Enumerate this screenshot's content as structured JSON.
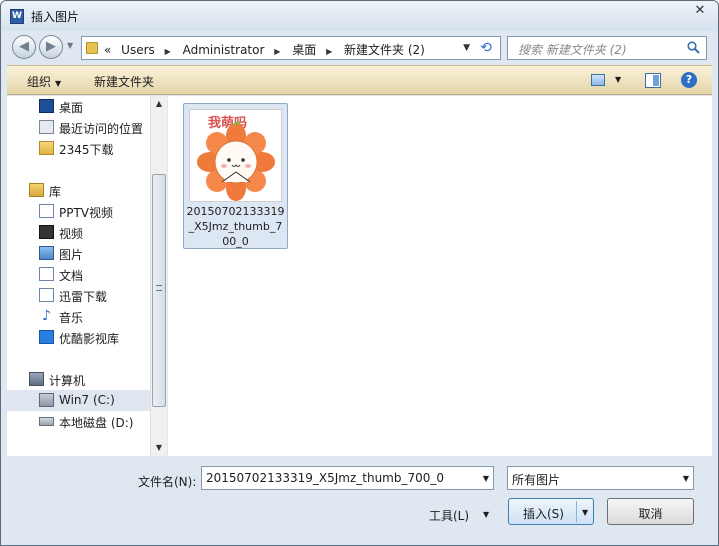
{
  "window": {
    "title": "插入图片",
    "close": "✕"
  },
  "address": {
    "crumb_prefix": "«",
    "crumbs": [
      "Users",
      "Administrator",
      "桌面",
      "新建文件夹 (2)"
    ],
    "search_placeholder": "搜索 新建文件夹 (2)"
  },
  "toolbar": {
    "organize": "组织",
    "new_folder": "新建文件夹",
    "help": "?"
  },
  "nav": {
    "items": [
      {
        "label": "桌面",
        "icon": "desktop-icon"
      },
      {
        "label": "最近访问的位置",
        "icon": "recent-places-icon"
      },
      {
        "label": "2345下载",
        "icon": "folder-icon"
      },
      {
        "label": "库",
        "icon": "library-icon"
      },
      {
        "label": "PPTV视频",
        "icon": "document-folder-icon"
      },
      {
        "label": "视频",
        "icon": "video-icon"
      },
      {
        "label": "图片",
        "icon": "pictures-icon"
      },
      {
        "label": "文档",
        "icon": "documents-icon"
      },
      {
        "label": "迅雷下载",
        "icon": "download-folder-icon"
      },
      {
        "label": "音乐",
        "icon": "music-icon"
      },
      {
        "label": "优酷影视库",
        "icon": "youku-icon"
      },
      {
        "label": "计算机",
        "icon": "computer-icon"
      },
      {
        "label": "Win7 (C:)",
        "icon": "drive-c-icon"
      },
      {
        "label": "本地磁盘 (D:)",
        "icon": "drive-d-icon"
      }
    ],
    "selected_index": 12
  },
  "files": [
    {
      "name": "20150702133319_X5Jmz_thumb_700_0",
      "thumb_caption": "我萌吗"
    }
  ],
  "bottom": {
    "filename_label": "文件名(N):",
    "filename_value": "20150702133319_X5Jmz_thumb_700_0",
    "type_value": "所有图片",
    "tools_label": "工具(L)",
    "insert_label": "插入(S)",
    "cancel_label": "取消"
  },
  "colors": {
    "toolbar_bg": "#ecdfb8",
    "selection": "#dde7f3",
    "accent": "#3c7fb1"
  }
}
